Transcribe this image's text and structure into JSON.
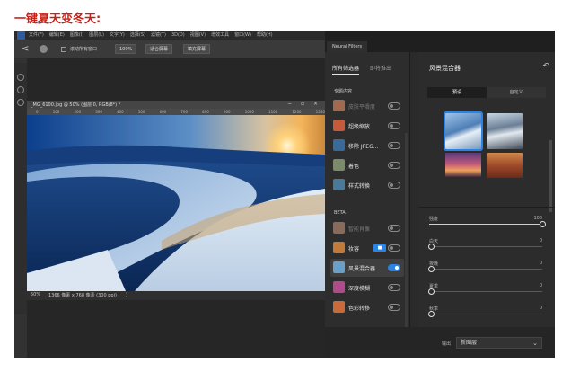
{
  "heading": "一键夏天变冬天:",
  "photoshop": {
    "menu": [
      "文件(F)",
      "编辑(E)",
      "图像(I)",
      "图层(L)",
      "文字(Y)",
      "选择(S)",
      "滤镜(T)",
      "3D(D)",
      "视图(V)",
      "增效工具",
      "窗口(W)",
      "帮助(H)"
    ],
    "options": {
      "back": "<",
      "scroll_all_label": "滚动所有窗口",
      "zoom_value": "100%",
      "fit_screen": "适合屏幕",
      "fill_screen": "填充屏幕"
    },
    "document_tab": "_MG_6100.jpg @ 50% (图层 0, RGB/8*) *",
    "window_controls": "− ▫ ×",
    "ruler_ticks": [
      "0",
      "100",
      "200",
      "300",
      "400",
      "500",
      "600",
      "700",
      "800",
      "900",
      "1000",
      "1100",
      "1200",
      "1300"
    ],
    "status": {
      "zoom": "50%",
      "size": "1366 像素 x 768 像素 (300 ppi)",
      "arrow": "〉"
    }
  },
  "neural_filters": {
    "panel_title": "Neural Filters",
    "tabs": {
      "all": "所有筛选器",
      "waitlist": "即将推出"
    },
    "featured_label": "专题内容",
    "featured": [
      {
        "name": "皮肤平滑度",
        "enabled": false,
        "dim": true,
        "color": "#a06a50"
      },
      {
        "name": "超级缩放",
        "enabled": false,
        "dim": false,
        "color": "#c65a3a"
      },
      {
        "name": "移除 JPEG...",
        "enabled": false,
        "dim": false,
        "color": "#3a6a9a"
      },
      {
        "name": "着色",
        "enabled": false,
        "dim": false,
        "color": "#7a8a6a"
      },
      {
        "name": "样式转换",
        "enabled": false,
        "dim": false,
        "color": "#4a7a9a"
      }
    ],
    "beta_label": "BETA",
    "beta": [
      {
        "name": "智能肖像",
        "enabled": false,
        "dim": true,
        "color": "#8a6a5a"
      },
      {
        "name": "妆容",
        "enabled": false,
        "dim": false,
        "color": "#c07a3a",
        "badge": "■"
      },
      {
        "name": "风景混合器",
        "enabled": true,
        "dim": false,
        "color": "#6aa0c8"
      },
      {
        "name": "深度模糊",
        "enabled": false,
        "dim": false,
        "color": "#b04a8a"
      },
      {
        "name": "色彩转移",
        "enabled": false,
        "dim": false,
        "color": "#c86a3a"
      }
    ],
    "detail": {
      "title": "风景混合器",
      "undo_icon": "↶",
      "segments": [
        "预设",
        "自定义"
      ],
      "active_segment": 0,
      "sliders": [
        {
          "label": "强度",
          "value": "100",
          "fraction": 1.0
        },
        {
          "label": "白天",
          "value": "0",
          "fraction": 0.0
        },
        {
          "label": "夜晚",
          "value": "0",
          "fraction": 0.0
        },
        {
          "label": "夏季",
          "value": "0",
          "fraction": 0.0
        },
        {
          "label": "秋季",
          "value": "0",
          "fraction": 0.0
        },
        {
          "label": "冬季",
          "value": "0",
          "fraction": 0.0
        }
      ],
      "output_label": "输出",
      "output_value": "新图层",
      "output_chevron": "⌄"
    }
  }
}
